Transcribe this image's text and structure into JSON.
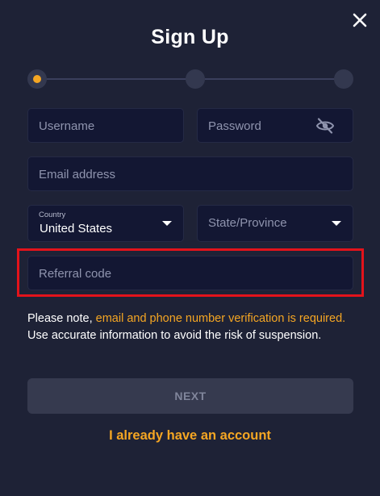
{
  "header": {
    "title": "Sign Up",
    "close_icon": "close-icon"
  },
  "stepper": {
    "total_steps": 3,
    "current_step": 1,
    "active_color": "#f5a623"
  },
  "form": {
    "username": {
      "placeholder": "Username",
      "value": ""
    },
    "password": {
      "placeholder": "Password",
      "value": "",
      "visibility_icon": "eye-off-icon"
    },
    "email": {
      "placeholder": "Email address",
      "value": ""
    },
    "country": {
      "label": "Country",
      "value": "United States"
    },
    "state": {
      "placeholder": "State/Province",
      "value": ""
    },
    "referral": {
      "placeholder": "Referral code",
      "value": ""
    }
  },
  "notice": {
    "prefix": "Please note, ",
    "highlight": "email and phone number verification is required.",
    "suffix": " Use accurate information to avoid the risk of suspension."
  },
  "actions": {
    "next_label": "NEXT",
    "login_link": "I already have an account"
  },
  "colors": {
    "background": "#1e2236",
    "field_background": "#131733",
    "accent": "#f5a623",
    "highlight_border": "#e3131b"
  }
}
